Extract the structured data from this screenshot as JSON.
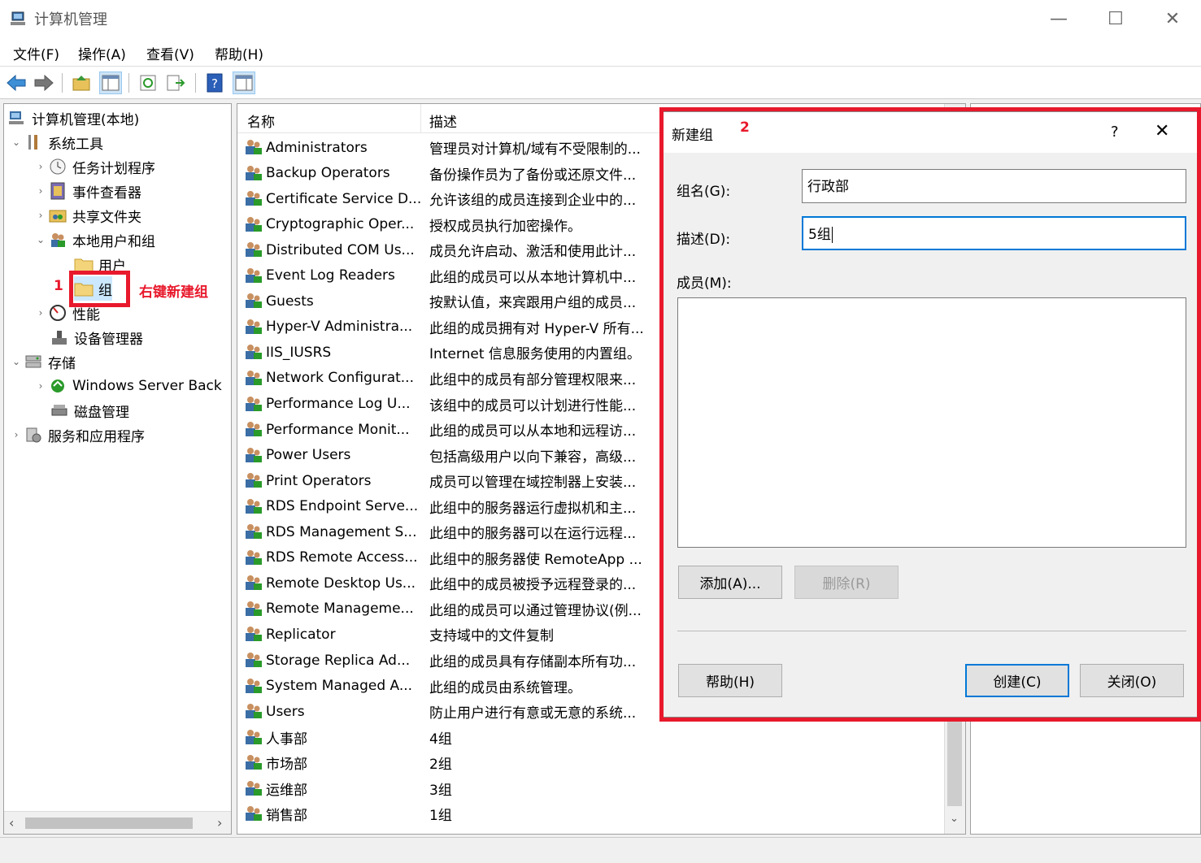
{
  "window": {
    "title": "计算机管理"
  },
  "menu": [
    "文件(F)",
    "操作(A)",
    "查看(V)",
    "帮助(H)"
  ],
  "tree": {
    "root": "计算机管理(本地)",
    "system_tools": "系统工具",
    "task_scheduler": "任务计划程序",
    "event_viewer": "事件查看器",
    "shared_folders": "共享文件夹",
    "local_users_groups": "本地用户和组",
    "users": "用户",
    "groups": "组",
    "performance": "性能",
    "device_manager": "设备管理器",
    "storage": "存储",
    "windows_server_backup": "Windows Server Back",
    "disk_management": "磁盘管理",
    "services_apps": "服务和应用程序"
  },
  "list": {
    "col_name": "名称",
    "col_desc": "描述",
    "rows": [
      {
        "name": "Administrators",
        "desc": "管理员对计算机/域有不受限制的..."
      },
      {
        "name": "Backup Operators",
        "desc": "备份操作员为了备份或还原文件..."
      },
      {
        "name": "Certificate Service D...",
        "desc": "允许该组的成员连接到企业中的..."
      },
      {
        "name": "Cryptographic Oper...",
        "desc": "授权成员执行加密操作。"
      },
      {
        "name": "Distributed COM Us...",
        "desc": "成员允许启动、激活和使用此计..."
      },
      {
        "name": "Event Log Readers",
        "desc": "此组的成员可以从本地计算机中..."
      },
      {
        "name": "Guests",
        "desc": "按默认值，来宾跟用户组的成员..."
      },
      {
        "name": "Hyper-V Administra...",
        "desc": "此组的成员拥有对 Hyper-V 所有..."
      },
      {
        "name": "IIS_IUSRS",
        "desc": "Internet 信息服务使用的内置组。"
      },
      {
        "name": "Network Configurat...",
        "desc": "此组中的成员有部分管理权限来..."
      },
      {
        "name": "Performance Log U...",
        "desc": "该组中的成员可以计划进行性能..."
      },
      {
        "name": "Performance Monit...",
        "desc": "此组的成员可以从本地和远程访..."
      },
      {
        "name": "Power Users",
        "desc": "包括高级用户以向下兼容，高级..."
      },
      {
        "name": "Print Operators",
        "desc": "成员可以管理在域控制器上安装..."
      },
      {
        "name": "RDS Endpoint Serve...",
        "desc": "此组中的服务器运行虚拟机和主..."
      },
      {
        "name": "RDS Management S...",
        "desc": "此组中的服务器可以在运行远程..."
      },
      {
        "name": "RDS Remote Access...",
        "desc": "此组中的服务器使 RemoteApp ..."
      },
      {
        "name": "Remote Desktop Us...",
        "desc": "此组中的成员被授予远程登录的..."
      },
      {
        "name": "Remote Manageme...",
        "desc": "此组的成员可以通过管理协议(例..."
      },
      {
        "name": "Replicator",
        "desc": "支持域中的文件复制"
      },
      {
        "name": "Storage Replica Ad...",
        "desc": "此组的成员具有存储副本所有功..."
      },
      {
        "name": "System Managed A...",
        "desc": "此组的成员由系统管理。"
      },
      {
        "name": "Users",
        "desc": "防止用户进行有意或无意的系统..."
      },
      {
        "name": "人事部",
        "desc": "4组"
      },
      {
        "name": "市场部",
        "desc": "2组"
      },
      {
        "name": "运维部",
        "desc": "3组"
      },
      {
        "name": "销售部",
        "desc": "1组"
      }
    ]
  },
  "dialog": {
    "title": "新建组",
    "help_glyph": "?",
    "group_name_label": "组名(G):",
    "group_name_value": "行政部",
    "desc_label": "描述(D):",
    "desc_value": "5组",
    "members_label": "成员(M):",
    "add_button": "添加(A)...",
    "remove_button": "删除(R)",
    "help_button": "帮助(H)",
    "create_button": "创建(C)",
    "close_button": "关闭(O)"
  },
  "annotations": {
    "step1": "1",
    "step1_text": "右键新建组",
    "step2": "2",
    "color": "#e8192c"
  }
}
